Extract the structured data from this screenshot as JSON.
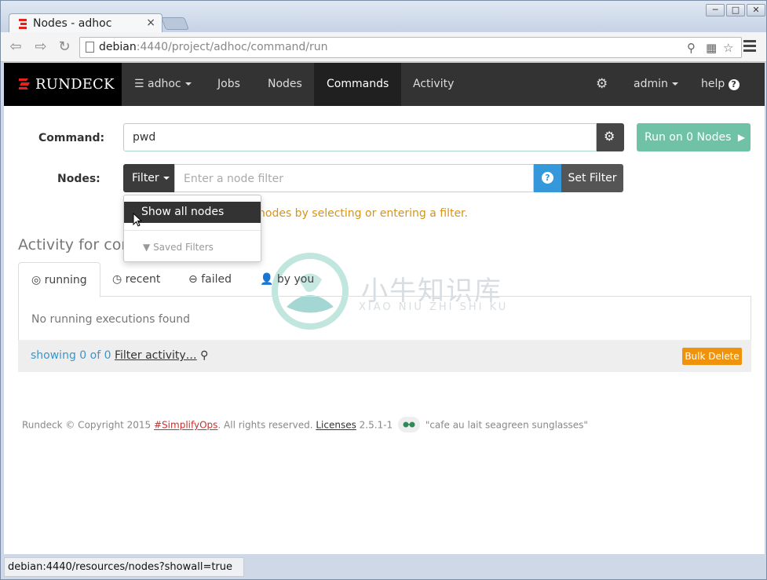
{
  "browser": {
    "tab_title": "Nodes - adhoc",
    "tab_close": "×",
    "url_host": "debian",
    "url_rest": ":4440/project/adhoc/command/run",
    "window_controls": [
      "minimize-icon",
      "maximize-icon",
      "close-icon"
    ],
    "status_url": "debian:4440/resources/nodes?showall=true"
  },
  "navbar": {
    "brand": "RUNDECK",
    "project": "adhoc",
    "items": [
      {
        "label": "Jobs",
        "active": false
      },
      {
        "label": "Nodes",
        "active": false
      },
      {
        "label": "Commands",
        "active": true
      },
      {
        "label": "Activity",
        "active": false
      }
    ],
    "user": "admin",
    "help": "help"
  },
  "command": {
    "label": "Command:",
    "value": "pwd",
    "run_button": "Run on 0 Nodes"
  },
  "nodes": {
    "label": "Nodes:",
    "filter_button": "Filter",
    "placeholder": "Enter a node filter",
    "set_filter": "Set Filter",
    "hint": "nodes by selecting or entering a filter."
  },
  "filter_menu": {
    "show_all": "Show all nodes",
    "saved_filters": "Saved Filters"
  },
  "activity": {
    "title": "Activity for com",
    "tabs": [
      "running",
      "recent",
      "failed",
      "by you"
    ],
    "empty": "No running executions found",
    "showing": "showing 0 of 0",
    "filter_link": "Filter activity…",
    "bulk_delete": "Bulk Delete"
  },
  "footer": {
    "copyright": "Rundeck © Copyright 2015 ",
    "simplify": "#SimplifyOps",
    "rights": ". All rights reserved. ",
    "licenses": "Licenses",
    "version": " 2.5.1-1 ",
    "codename": " \"cafe au lait seagreen sunglasses\""
  },
  "watermark": {
    "cn": "小牛知识库",
    "en": "XIAO NIU ZHI SHI KU"
  },
  "colors": {
    "accent_red": "#e2231a",
    "run_green": "#6fc2a6",
    "info_blue": "#3498db",
    "warning_orange": "#f0930c"
  }
}
